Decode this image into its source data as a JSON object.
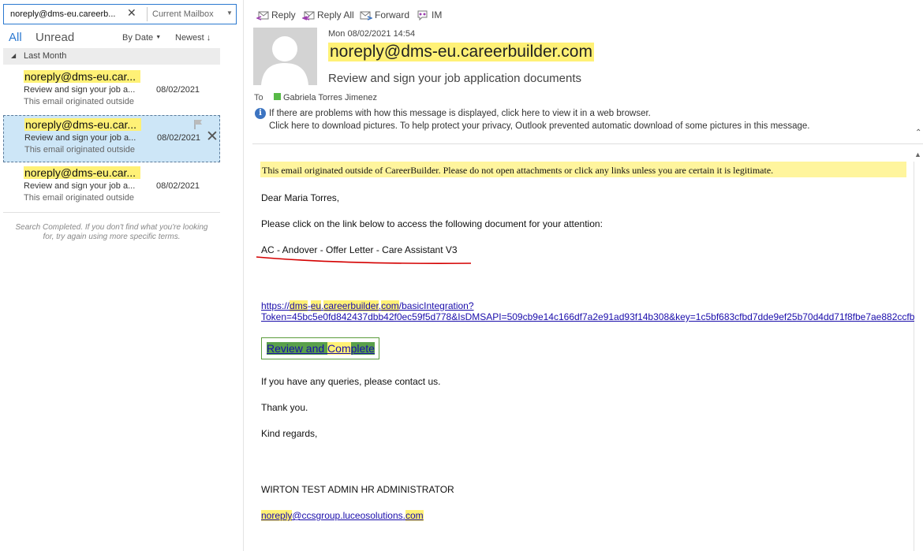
{
  "search": {
    "query": "noreply@dms-eu.careerb...",
    "scope": "Current Mailbox"
  },
  "filters": {
    "all": "All",
    "unread": "Unread",
    "sort_by": "By Date",
    "order": "Newest"
  },
  "group": {
    "label": "Last Month"
  },
  "messages": [
    {
      "from": "noreply@dms-eu.car...",
      "subject": "Review and sign your job a...",
      "date": "08/02/2021",
      "preview": "This email originated outside"
    },
    {
      "from": "noreply@dms-eu.car...",
      "subject": "Review and sign your job a...",
      "date": "08/02/2021",
      "preview": "This email originated outside"
    },
    {
      "from": "noreply@dms-eu.car...",
      "subject": "Review and sign your job a...",
      "date": "08/02/2021",
      "preview": "This email originated outside"
    }
  ],
  "search_note": {
    "line1": "Search Completed. If you don't find what you're looking",
    "line2": "for, try again using more specific terms."
  },
  "toolbar": {
    "reply": "Reply",
    "reply_all": "Reply All",
    "forward": "Forward",
    "im": "IM"
  },
  "header": {
    "time": "Mon 08/02/2021 14:54",
    "sender": "noreply@dms-eu.careerbuilder.com",
    "subject": "Review and sign your job application documents",
    "to_label": "To",
    "to_name": "Gabriela Torres Jimenez",
    "info_line1": "If there are problems with how this message is displayed, click here to view it in a web browser.",
    "info_line2": "Click here to download pictures. To help protect your privacy, Outlook prevented automatic download of some pictures in this message."
  },
  "body": {
    "warning": "This email originated outside of CareerBuilder. Please do not open attachments or click any links unless you are certain it is legitimate.",
    "greeting": "Dear Maria Torres,",
    "instruction": "Please click on the link below to access the following document for your attention:",
    "document": "AC - Andover - Offer Letter - Care Assistant V3",
    "url": {
      "p1": "https://",
      "p2": "dms",
      "p3": "-",
      "p4": "eu",
      "p5": ".",
      "p6": "careerbuilder",
      "p7": ".",
      "p8": "com",
      "p9": "/basicIntegration?",
      "line2": "Token=45bc5e0fd842437dbb42f0ec59f5d778&IsDMSAPI=509cb9e14c166df7a2e91ad93f14b308&key=1c5bf683cfbd7dde9ef25b70d4dd71f8fbe7ae882ccfb"
    },
    "review_button": {
      "p1": "Review and ",
      "p2": "Com",
      "p3": "plete"
    },
    "queries": "If you have any queries, please contact us.",
    "thanks": "Thank you.",
    "regards": "Kind regards,",
    "signature": "WIRTON TEST ADMIN HR ADMINISTRATOR",
    "email": {
      "p1": "noreply",
      "p2": "@ccsgroup.luceosolutions",
      "p3": ".",
      "p4": "com"
    }
  },
  "colors": {
    "accent": "#2b78d0",
    "highlight": "#fff176",
    "selected_row": "#cde6f7",
    "warning_bg": "#fff59d",
    "button_green": "#59a04a",
    "presence": "#57b947"
  }
}
